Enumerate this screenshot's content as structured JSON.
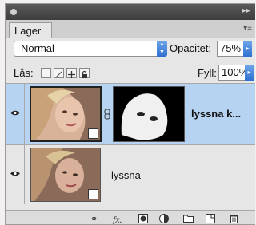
{
  "panel": {
    "tab_label": "Lager"
  },
  "controls": {
    "blend_mode": "Normal",
    "opacity_label": "Opacitet:",
    "opacity_value": "75%",
    "lock_label": "Lås:",
    "fill_label": "Fyll:",
    "fill_value": "100%"
  },
  "layers": [
    {
      "name": "lyssna k...",
      "selected": true,
      "has_mask": true
    },
    {
      "name": "lyssna",
      "selected": false,
      "has_mask": false
    }
  ],
  "colors": {
    "selected_row": "#b6d3f2",
    "accent_blue": "#2f6fd0"
  }
}
